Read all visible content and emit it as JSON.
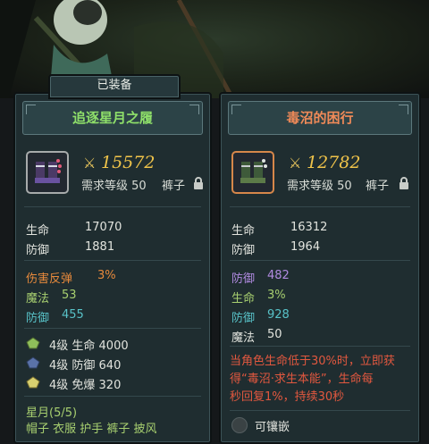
{
  "equipped_tab": "已装备",
  "colors": {
    "green_title": "#8fe06a",
    "orange_title": "#f08a58",
    "gold": "#f0c44a",
    "orange_stat": "#e88a3c",
    "green_stat": "#a8d070",
    "cyan_stat": "#58c2c8",
    "purple_stat": "#b08ae0",
    "red_desc": "#e2583f"
  },
  "left": {
    "title": "追逐星月之履",
    "power_icon": "sword-power-icon",
    "power": "15572",
    "req_level": "需求等级 50",
    "slot": "裤子",
    "base_stats": [
      {
        "name": "生命",
        "value": "17070"
      },
      {
        "name": "防御",
        "value": "1881"
      }
    ],
    "bonus_stats": [
      {
        "name": "伤害反弹",
        "value": "3%"
      },
      {
        "name": "魔法",
        "value": "53"
      },
      {
        "name": "防御",
        "value": "455"
      }
    ],
    "gems": [
      {
        "icon": "green-gem-icon",
        "text": "4级  生命 4000"
      },
      {
        "icon": "blue-gem-icon",
        "text": "4级  防御 640"
      },
      {
        "icon": "yellow-gem-icon",
        "text": "4级  免爆 320"
      }
    ],
    "set_name": "星月(5/5)",
    "set_pieces": "帽子 衣服 护手 裤子 披风"
  },
  "right": {
    "title": "毒沼的困行",
    "power_icon": "sword-power-icon",
    "power": "12782",
    "req_level": "需求等级 50",
    "slot": "裤子",
    "base_stats": [
      {
        "name": "生命",
        "value": "16312"
      },
      {
        "name": "防御",
        "value": "1964"
      }
    ],
    "bonus_stats": [
      {
        "name": "防御",
        "value": "482"
      },
      {
        "name": "生命",
        "value": "3%"
      },
      {
        "name": "防御",
        "value": "928"
      },
      {
        "name": "魔法",
        "value": "50"
      }
    ],
    "special_desc_lines": [
      "当角色生命低于30%时，立即获",
      "得“毒沼·求生本能”，生命每",
      "秒回复1%，持续30秒"
    ],
    "socket_label": "可镶嵌"
  }
}
